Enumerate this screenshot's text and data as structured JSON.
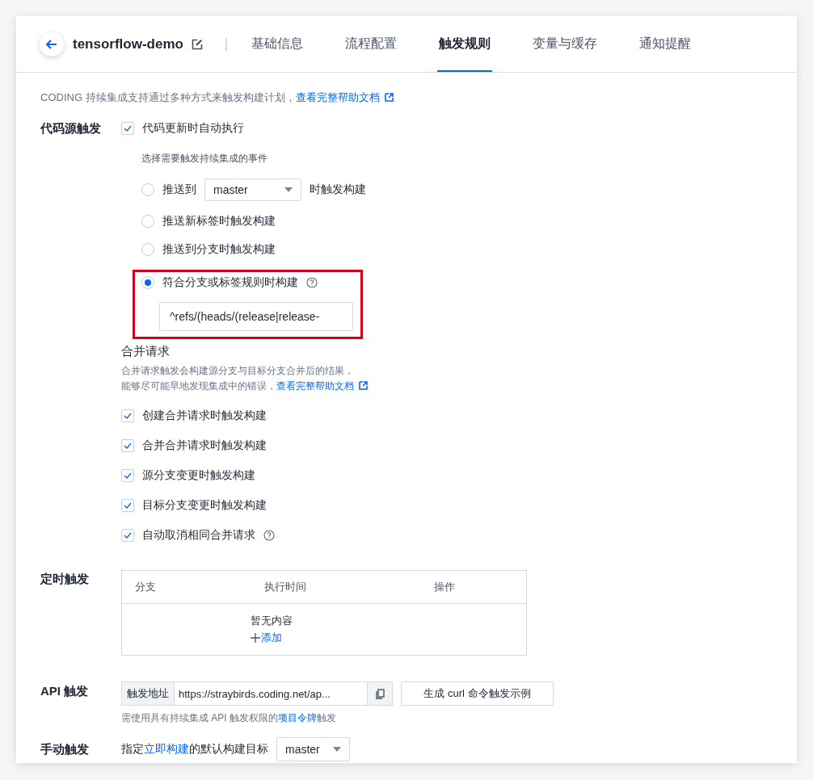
{
  "header": {
    "title": "tensorflow-demo",
    "tabs": [
      {
        "label": "基础信息",
        "selected": false
      },
      {
        "label": "流程配置",
        "selected": false
      },
      {
        "label": "触发规则",
        "selected": true
      },
      {
        "label": "变量与缓存",
        "selected": false
      },
      {
        "label": "通知提醒",
        "selected": false
      }
    ]
  },
  "intro": {
    "text": "CODING 持续集成支持通过多种方式来触发构建计划，",
    "link": "查看完整帮助文档"
  },
  "source_trigger": {
    "label": "代码源触发",
    "auto_run": {
      "label": "代码更新时自动执行",
      "checked": true
    },
    "events_hint": "选择需要触发持续集成的事件",
    "events": [
      {
        "kind": "branch",
        "before": "推送到",
        "branch": "master",
        "after": "时触发构建",
        "selected": false
      },
      {
        "kind": "plain",
        "label": "推送新标签时触发构建",
        "selected": false
      },
      {
        "kind": "plain",
        "label": "推送到分支时触发构建",
        "selected": false
      },
      {
        "kind": "rule",
        "label": "符合分支或标签规则时构建",
        "rule": "^refs/(heads/(release|release-",
        "selected": true,
        "highlighted": true
      }
    ],
    "merge_request": {
      "title": "合并请求",
      "desc_line1": "合并请求触发会构建源分支与目标分支合并后的结果，",
      "desc_line2": "能够尽可能早地发现集成中的错误，",
      "link": "查看完整帮助文档",
      "options": [
        {
          "label": "创建合并请求时触发构建",
          "checked": true
        },
        {
          "label": "合并合并请求时触发构建",
          "checked": true
        },
        {
          "label": "源分支变更时触发构建",
          "checked": true
        },
        {
          "label": "目标分支变更时触发构建",
          "checked": true
        },
        {
          "label": "自动取消相同合并请求",
          "checked": true,
          "help": true
        }
      ]
    }
  },
  "schedule": {
    "label": "定时触发",
    "columns": [
      "分支",
      "执行时间",
      "操作"
    ],
    "empty": "暂无内容",
    "add": "添加"
  },
  "api": {
    "label": "API 触发",
    "addon": "触发地址",
    "url": "https://straybirds.coding.net/ap...",
    "button": "生成 curl 命令触发示例",
    "note_before": "需使用具有持续集成 API 触发权限的",
    "note_link": "项目令牌",
    "note_after": "触发"
  },
  "manual": {
    "label": "手动触发",
    "before": "指定",
    "link": "立即构建",
    "after": "的默认构建目标",
    "branch": "master"
  }
}
